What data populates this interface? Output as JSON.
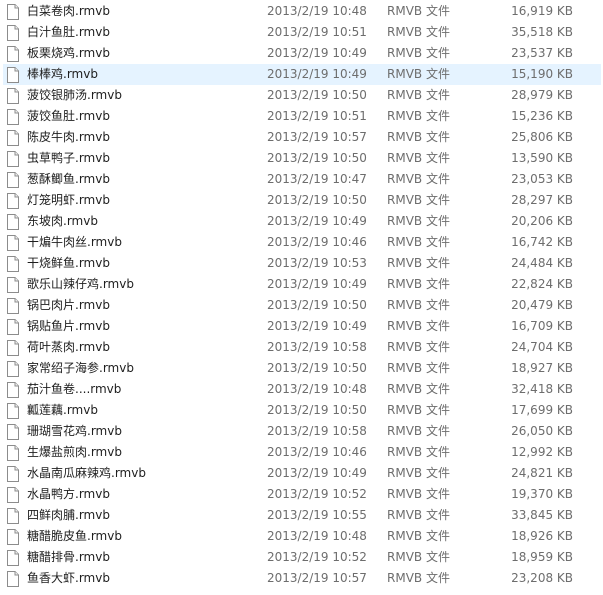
{
  "files": [
    {
      "name": "白菜卷肉.rmvb",
      "date": "2013/2/19 10:48",
      "type": "RMVB 文件",
      "size": "16,919 KB"
    },
    {
      "name": "白汁鱼肚.rmvb",
      "date": "2013/2/19 10:51",
      "type": "RMVB 文件",
      "size": "35,518 KB"
    },
    {
      "name": "板栗烧鸡.rmvb",
      "date": "2013/2/19 10:49",
      "type": "RMVB 文件",
      "size": "23,537 KB"
    },
    {
      "name": "棒棒鸡.rmvb",
      "date": "2013/2/19 10:49",
      "type": "RMVB 文件",
      "size": "15,190 KB",
      "hover": true
    },
    {
      "name": "菠饺银肺汤.rmvb",
      "date": "2013/2/19 10:50",
      "type": "RMVB 文件",
      "size": "28,979 KB"
    },
    {
      "name": "菠饺鱼肚.rmvb",
      "date": "2013/2/19 10:51",
      "type": "RMVB 文件",
      "size": "15,236 KB"
    },
    {
      "name": "陈皮牛肉.rmvb",
      "date": "2013/2/19 10:57",
      "type": "RMVB 文件",
      "size": "25,806 KB"
    },
    {
      "name": "虫草鸭子.rmvb",
      "date": "2013/2/19 10:50",
      "type": "RMVB 文件",
      "size": "13,590 KB"
    },
    {
      "name": "葱酥鲫鱼.rmvb",
      "date": "2013/2/19 10:47",
      "type": "RMVB 文件",
      "size": "23,053 KB"
    },
    {
      "name": "灯笼明虾.rmvb",
      "date": "2013/2/19 10:50",
      "type": "RMVB 文件",
      "size": "28,297 KB"
    },
    {
      "name": "东坡肉.rmvb",
      "date": "2013/2/19 10:49",
      "type": "RMVB 文件",
      "size": "20,206 KB"
    },
    {
      "name": "干煸牛肉丝.rmvb",
      "date": "2013/2/19 10:46",
      "type": "RMVB 文件",
      "size": "16,742 KB"
    },
    {
      "name": "干烧鲜鱼.rmvb",
      "date": "2013/2/19 10:53",
      "type": "RMVB 文件",
      "size": "24,484 KB"
    },
    {
      "name": "歌乐山辣仔鸡.rmvb",
      "date": "2013/2/19 10:49",
      "type": "RMVB 文件",
      "size": "22,824 KB"
    },
    {
      "name": "锅巴肉片.rmvb",
      "date": "2013/2/19 10:50",
      "type": "RMVB 文件",
      "size": "20,479 KB"
    },
    {
      "name": "锅贴鱼片.rmvb",
      "date": "2013/2/19 10:49",
      "type": "RMVB 文件",
      "size": "16,709 KB"
    },
    {
      "name": "荷叶蒸肉.rmvb",
      "date": "2013/2/19 10:58",
      "type": "RMVB 文件",
      "size": "24,704 KB"
    },
    {
      "name": "家常绍子海参.rmvb",
      "date": "2013/2/19 10:50",
      "type": "RMVB 文件",
      "size": "18,927 KB"
    },
    {
      "name": "茄汁鱼卷....rmvb",
      "date": "2013/2/19 10:48",
      "type": "RMVB 文件",
      "size": "32,418 KB"
    },
    {
      "name": "瓤莲藕.rmvb",
      "date": "2013/2/19 10:50",
      "type": "RMVB 文件",
      "size": "17,699 KB"
    },
    {
      "name": "珊瑚雪花鸡.rmvb",
      "date": "2013/2/19 10:58",
      "type": "RMVB 文件",
      "size": "26,050 KB"
    },
    {
      "name": "生爆盐煎肉.rmvb",
      "date": "2013/2/19 10:46",
      "type": "RMVB 文件",
      "size": "12,992 KB"
    },
    {
      "name": "水晶南瓜麻辣鸡.rmvb",
      "date": "2013/2/19 10:49",
      "type": "RMVB 文件",
      "size": "24,821 KB"
    },
    {
      "name": "水晶鸭方.rmvb",
      "date": "2013/2/19 10:52",
      "type": "RMVB 文件",
      "size": "19,370 KB"
    },
    {
      "name": "四鲜肉脯.rmvb",
      "date": "2013/2/19 10:55",
      "type": "RMVB 文件",
      "size": "33,845 KB"
    },
    {
      "name": "糖醋脆皮鱼.rmvb",
      "date": "2013/2/19 10:48",
      "type": "RMVB 文件",
      "size": "18,926 KB"
    },
    {
      "name": "糖醋排骨.rmvb",
      "date": "2013/2/19 10:52",
      "type": "RMVB 文件",
      "size": "18,959 KB"
    },
    {
      "name": "鱼香大虾.rmvb",
      "date": "2013/2/19 10:57",
      "type": "RMVB 文件",
      "size": "23,208 KB"
    }
  ],
  "icon": "blank-file-icon",
  "colors": {
    "hover_background": "#e5f3ff",
    "name_text": "#1e1e1e",
    "detail_text": "#6d6d6d"
  }
}
